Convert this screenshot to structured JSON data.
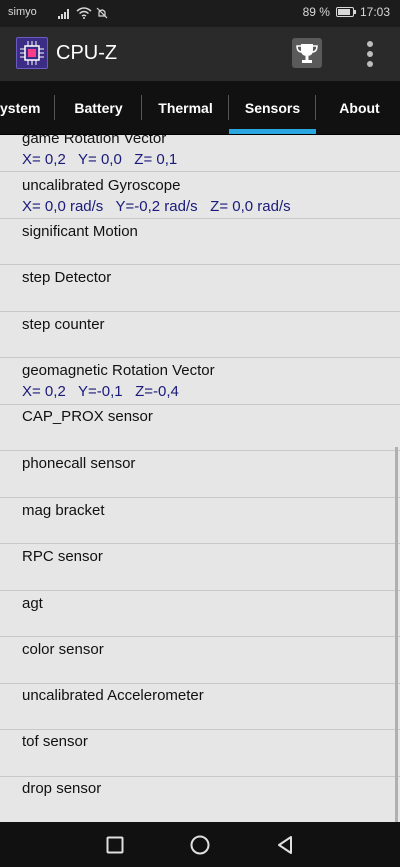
{
  "status_bar": {
    "carrier": "simyo",
    "battery_percent": "89 %",
    "battery_level": 0.89,
    "time": "17:03",
    "icons": [
      "signal-icon",
      "wifi-icon",
      "mute-icon",
      "battery-icon"
    ]
  },
  "app_bar": {
    "title": "CPU-Z",
    "icons": [
      "cpu-logo-icon",
      "trophy-icon",
      "overflow-menu-icon"
    ]
  },
  "tabs": [
    {
      "label": "ystem"
    },
    {
      "label": "Battery"
    },
    {
      "label": "Thermal"
    },
    {
      "label": "Sensors",
      "active": true
    },
    {
      "label": "About"
    }
  ],
  "sensors": [
    {
      "name": "game Rotation Vector",
      "value": "X= 0,2   Y= 0,0   Z= 0,1"
    },
    {
      "name": "uncalibrated Gyroscope",
      "value": "X= 0,0 rad/s   Y=-0,2 rad/s   Z= 0,0 rad/s"
    },
    {
      "name": "significant Motion",
      "value": ""
    },
    {
      "name": "step Detector",
      "value": ""
    },
    {
      "name": "step counter",
      "value": ""
    },
    {
      "name": "geomagnetic Rotation Vector",
      "value": "X= 0,2   Y=-0,1   Z=-0,4"
    },
    {
      "name": "CAP_PROX sensor",
      "value": ""
    },
    {
      "name": "phonecall sensor",
      "value": ""
    },
    {
      "name": "mag bracket",
      "value": ""
    },
    {
      "name": "RPC sensor",
      "value": ""
    },
    {
      "name": "agt",
      "value": ""
    },
    {
      "name": "color sensor",
      "value": ""
    },
    {
      "name": "uncalibrated Accelerometer",
      "value": ""
    },
    {
      "name": "tof sensor",
      "value": ""
    },
    {
      "name": "drop sensor",
      "value": ""
    }
  ],
  "nav_bar": {
    "icons": [
      "recent-apps-icon",
      "home-icon",
      "back-icon"
    ]
  },
  "colors": {
    "accent": "#2aa6e0",
    "value_text": "#1a1a7a",
    "list_background": "#e6e6e6",
    "app_bar": "#2a2a2a",
    "tab_bar": "#111111"
  }
}
